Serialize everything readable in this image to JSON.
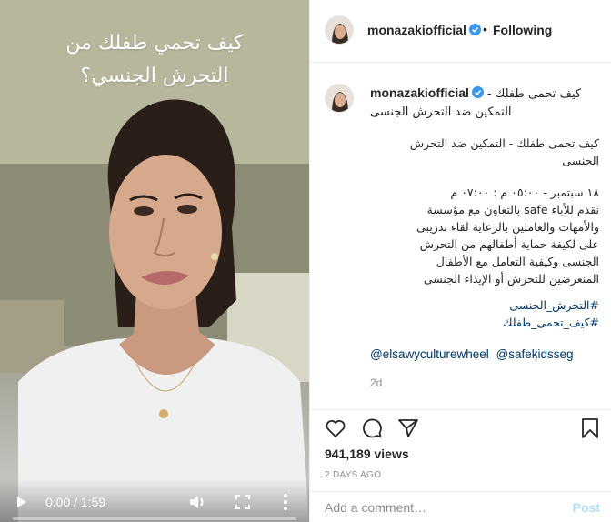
{
  "video": {
    "overlay_line1": "كيف تحمي طفلك من",
    "overlay_line2": "التحرش الجنسي؟",
    "time": "0:00 / 1:59",
    "progress_fraction": 0.0
  },
  "header": {
    "username": "monazakiofficial",
    "dot": "•",
    "follow_label": "Following"
  },
  "caption": {
    "username": "monazakiofficial",
    "title": "كيف تحمى طفلك - التمكين ضد التحرش الجنسى",
    "para1": "كيف تحمى طفلك - التمكين ضد التحرش الجنسى",
    "para2_line1": "١٨ سبتمبر - ٠٥:٠٠ م : ٠٧:٠٠ م",
    "para2_line2": "نقدم للأباء safe بالتعاون مع مؤسسة",
    "para2_line3": "والأمهات والعاملين بالرعاية لقاء تدريبى",
    "para2_line4": "على لكيفة حماية أطفالهم من التحرش",
    "para2_line5": "الجنسى وكيفية التعامل مع الأطفال",
    "para2_line6": "المنعرضين للتحرش أو الإيذاء الجنسى",
    "hashtag1": "#التحرش_الجنسى",
    "hashtag2": "#كيف_تحمى_طفلك",
    "mention1": "@elsawyculturewheel",
    "mention2": "@safekidsseg",
    "age": "2d"
  },
  "actions": {
    "views": "941,189 views",
    "posted": "2 DAYS AGO"
  },
  "comment": {
    "placeholder": "Add a comment…",
    "post_label": "Post"
  },
  "colors": {
    "verified": "#3897f0",
    "link": "#00376b",
    "muted": "#8e8e8e",
    "post_disabled": "#b2dffc"
  }
}
